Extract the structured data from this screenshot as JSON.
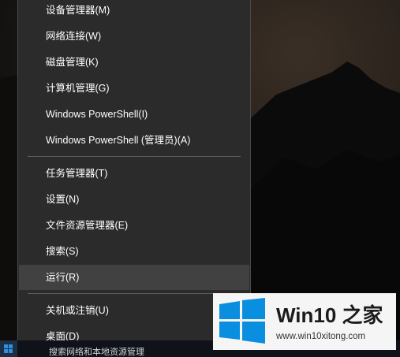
{
  "menu": {
    "items_group1": [
      {
        "label": "设备管理器(M)"
      },
      {
        "label": "网络连接(W)"
      },
      {
        "label": "磁盘管理(K)"
      },
      {
        "label": "计算机管理(G)"
      },
      {
        "label": "Windows PowerShell(I)"
      },
      {
        "label": "Windows PowerShell (管理员)(A)"
      }
    ],
    "items_group2": [
      {
        "label": "任务管理器(T)"
      },
      {
        "label": "设置(N)"
      },
      {
        "label": "文件资源管理器(E)"
      },
      {
        "label": "搜索(S)"
      },
      {
        "label": "运行(R)"
      }
    ],
    "items_group3": [
      {
        "label": "关机或注销(U)"
      },
      {
        "label": "桌面(D)"
      }
    ],
    "highlighted_item": "运行(R)"
  },
  "taskbar": {
    "partial_text": "搜索网络和本地资源管理"
  },
  "watermark": {
    "title": "Win10 之家",
    "url": "www.win10xitong.com",
    "logo_icon": "windows-logo-icon"
  },
  "colors": {
    "menu_bg": "#2b2b2b",
    "menu_hover": "#414141",
    "menu_text": "#ffffff",
    "windows_blue": "#0a8ee0"
  }
}
